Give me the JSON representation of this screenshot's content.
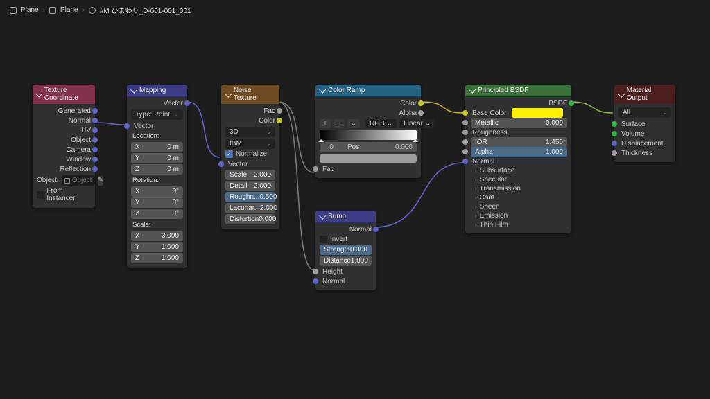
{
  "breadcrumb": {
    "a": "Plane",
    "b": "Plane",
    "c": "#M ひまわり_D-001-001_001"
  },
  "texcoord": {
    "title": "Texture Coordinate",
    "outs": [
      "Generated",
      "Normal",
      "UV",
      "Object",
      "Camera",
      "Window",
      "Reflection"
    ],
    "obj_label": "Object:",
    "obj_placeholder": "Object",
    "from_instancer": "From Instancer"
  },
  "mapping": {
    "title": "Mapping",
    "out": "Vector",
    "type_label": "Type:",
    "type_value": "Point",
    "vector_in": "Vector",
    "loc_label": "Location:",
    "loc": [
      {
        "a": "X",
        "v": "0 m"
      },
      {
        "a": "Y",
        "v": "0 m"
      },
      {
        "a": "Z",
        "v": "0 m"
      }
    ],
    "rot_label": "Rotation:",
    "rot": [
      {
        "a": "X",
        "v": "0°"
      },
      {
        "a": "Y",
        "v": "0°"
      },
      {
        "a": "Z",
        "v": "0°"
      }
    ],
    "scale_label": "Scale:",
    "scale": [
      {
        "a": "X",
        "v": "3.000"
      },
      {
        "a": "Y",
        "v": "1.000"
      },
      {
        "a": "Z",
        "v": "1.000"
      }
    ]
  },
  "noise": {
    "title": "Noise Texture",
    "outs": {
      "fac": "Fac",
      "color": "Color"
    },
    "dim": "3D",
    "mode": "fBM",
    "normalize": "Normalize",
    "vector_in": "Vector",
    "props": [
      {
        "n": "Scale",
        "v": "2.000"
      },
      {
        "n": "Detail",
        "v": "2.000"
      },
      {
        "n": "Roughn...",
        "v": "0.500",
        "hl": true
      },
      {
        "n": "Lacunar...",
        "v": "2.000"
      },
      {
        "n": "Distortion",
        "v": "0.000"
      }
    ]
  },
  "ramp": {
    "title": "Color Ramp",
    "outs": {
      "color": "Color",
      "alpha": "Alpha"
    },
    "interp": "RGB",
    "mode": "Linear",
    "idx": "0",
    "pos_label": "Pos",
    "pos_val": "0.000",
    "fac_in": "Fac"
  },
  "bump": {
    "title": "Bump",
    "out": "Normal",
    "invert": "Invert",
    "strength": {
      "n": "Strength",
      "v": "0.300"
    },
    "distance": {
      "n": "Distance",
      "v": "1.000"
    },
    "height_in": "Height",
    "normal_in": "Normal"
  },
  "bsdf": {
    "title": "Principled BSDF",
    "out": "BSDF",
    "base_color": "Base Color",
    "metallic": {
      "n": "Metallic",
      "v": "0.000"
    },
    "roughness": "Roughness",
    "ior": {
      "n": "IOR",
      "v": "1.450"
    },
    "alpha": {
      "n": "Alpha",
      "v": "1.000"
    },
    "normal_in": "Normal",
    "subs": [
      "Subsurface",
      "Specular",
      "Transmission",
      "Coat",
      "Sheen",
      "Emission",
      "Thin Film"
    ]
  },
  "out": {
    "title": "Material Output",
    "target": "All",
    "ins": [
      "Surface",
      "Volume",
      "Displacement",
      "Thickness"
    ]
  }
}
